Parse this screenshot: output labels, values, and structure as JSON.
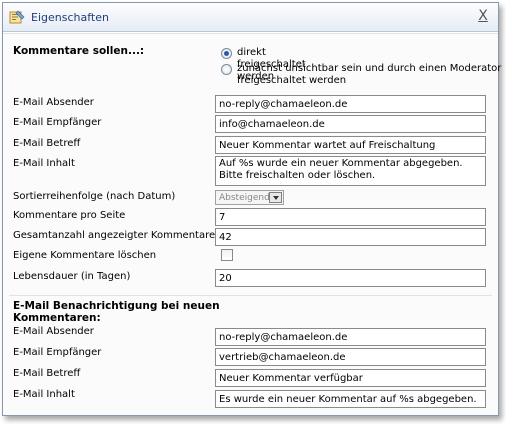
{
  "window": {
    "title": "Eigenschaften",
    "close_glyph": "X",
    "icon": "properties-icon"
  },
  "comments": {
    "heading": "Kommentare sollen...:",
    "options": [
      {
        "label": "direkt freigeschaltet werden",
        "checked": true
      },
      {
        "label_line1": "zunächst unsichtbar sein und durch einen Moderator",
        "label_line2": "freigeschaltet werden",
        "checked": false
      }
    ],
    "fields": {
      "sender_label": "E-Mail Absender",
      "sender_value": "no-reply@chamaeleon.de",
      "recipient_label": "E-Mail Empfänger",
      "recipient_value": "info@chamaeleon.de",
      "subject_label": "E-Mail Betreff",
      "subject_value": "Neuer Kommentar wartet auf Freischaltung",
      "content_label": "E-Mail Inhalt",
      "content_value": "Auf %s wurde ein neuer Kommentar abgegeben. Bitte freischalten oder löschen.",
      "sort_label": "Sortierreihenfolge (nach Datum)",
      "sort_value": "Absteigend",
      "per_page_label": "Kommentare pro Seite",
      "per_page_value": "7",
      "total_label": "Gesamtanzahl angezeigter Kommentare",
      "total_value": "42",
      "delete_own_label": "Eigene Kommentare löschen",
      "delete_own_checked": false,
      "lifetime_label": "Lebensdauer (in Tagen)",
      "lifetime_value": "20"
    }
  },
  "notification": {
    "heading_line1": "E-Mail Benachrichtigung bei neuen",
    "heading_line2": "Kommentaren:",
    "sender_label": "E-Mail Absender",
    "sender_value": "no-reply@chamaeleon.de",
    "recipient_label": "E-Mail Empfänger",
    "recipient_value": "vertrieb@chamaeleon.de",
    "subject_label": "E-Mail Betreff",
    "subject_value": "Neuer Kommentar verfügbar",
    "content_label": "E-Mail Inhalt",
    "content_value": "Es wurde ein neuer Kommentar auf %s abgegeben."
  }
}
